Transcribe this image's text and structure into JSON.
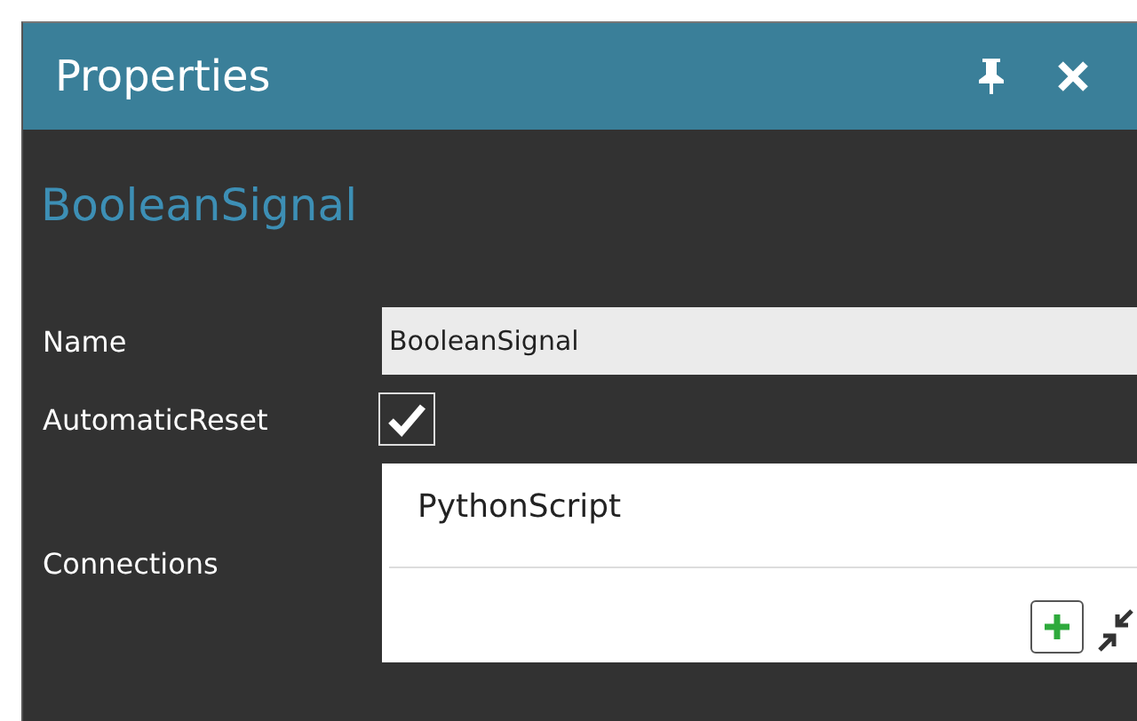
{
  "panel": {
    "title": "Properties"
  },
  "heading": "BooleanSignal",
  "fields": [
    {
      "kind": "text",
      "label": "Name",
      "value": "BooleanSignal"
    },
    {
      "kind": "checkbox",
      "label": "AutomaticReset",
      "checked": true
    },
    {
      "kind": "list",
      "label": "Connections",
      "items": [
        "PythonScript"
      ]
    }
  ]
}
